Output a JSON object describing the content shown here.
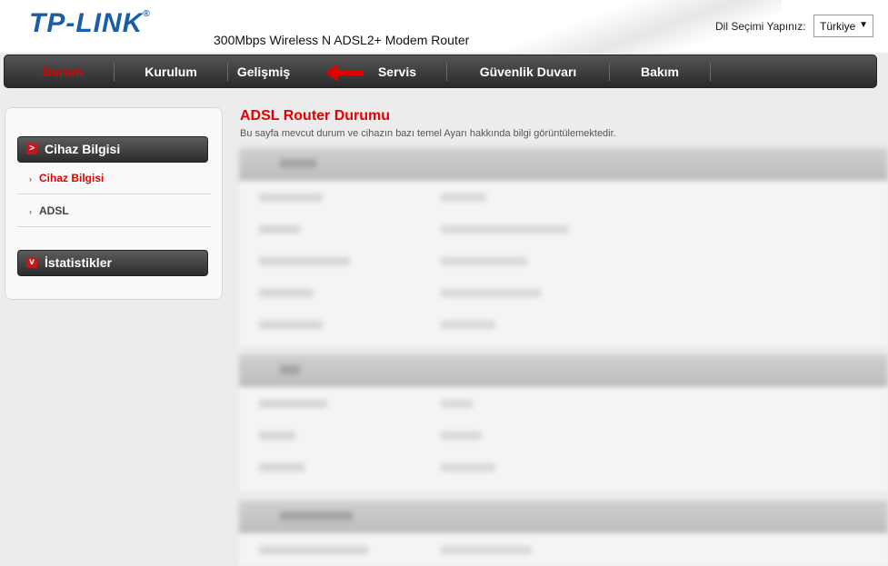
{
  "header": {
    "logo": "TP-LINK",
    "logo_mark": "®",
    "model": "300Mbps Wireless N ADSL2+ Modem Router",
    "language_label": "Dil Seçimi Yapınız:",
    "language_value": "Türkiye"
  },
  "topnav": {
    "items": [
      {
        "label": "Durum",
        "active": true
      },
      {
        "label": "Kurulum"
      },
      {
        "label": "Gelişmiş"
      },
      {
        "label": "Servis"
      },
      {
        "label": "Güvenlik Duvarı"
      },
      {
        "label": "Bakım"
      }
    ]
  },
  "sidebar": {
    "groups": [
      {
        "title": "Cihaz Bilgisi",
        "icon": "chevron-right-icon"
      },
      {
        "title": "İstatistikler",
        "icon": "chevron-down-icon"
      }
    ],
    "links": [
      {
        "label": "Cihaz Bilgisi",
        "active": true
      },
      {
        "label": "ADSL"
      }
    ]
  },
  "content": {
    "title": "ADSL Router Durumu",
    "description": "Bu sayfa mevcut durum ve cihazın bazı temel Ayarı hakkında bilgi görüntülemektedir."
  },
  "colors": {
    "brand": "#1a5ea8",
    "accent": "#e00000",
    "nav_bg": "#333333"
  }
}
